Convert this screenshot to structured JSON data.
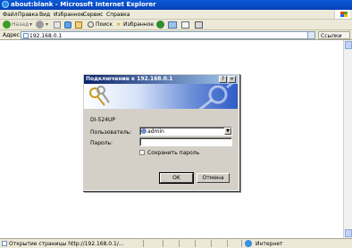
{
  "window": {
    "title": "about:blank - Microsoft Internet Explorer"
  },
  "menu": {
    "items": [
      "Файл",
      "Правка",
      "Вид",
      "Избранное",
      "Сервис",
      "Справка"
    ]
  },
  "toolbar": {
    "back_label": "Назад",
    "search_label": "Поиск",
    "favorites_label": "Избранное"
  },
  "address": {
    "label": "Адрес",
    "value": "192.168.0.1",
    "go_label": "Ссылки"
  },
  "dialog": {
    "title": "Подключение к 192.168.0.1",
    "help_label": "?",
    "close_label": "×",
    "device": "DI-524UP",
    "username_label": "Пользователь:",
    "username_value": "admin",
    "password_label": "Пароль:",
    "password_value": "",
    "remember_label": "Сохранить пароль",
    "ok_label": "OK",
    "cancel_label": "Отмена"
  },
  "status": {
    "text": "Открытие страницы http://192.168.0.1/...",
    "zone": "Интернет"
  },
  "colors": {
    "xp_blue": "#0a5ad8",
    "dialog_title": "#0a246a",
    "face": "#d4d0c8",
    "chrome": "#ece9d8"
  }
}
